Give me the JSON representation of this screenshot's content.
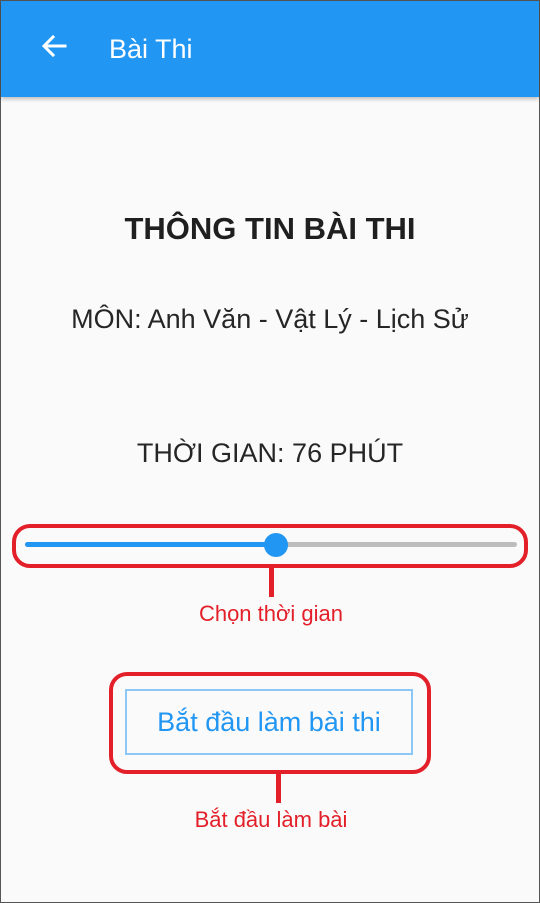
{
  "appbar": {
    "title": "Bài Thi",
    "back_icon": "arrow-left-icon",
    "color": "#2196f3"
  },
  "exam_info": {
    "heading": "THÔNG TIN BÀI THI",
    "subject": "MÔN: Anh Văn - Vật Lý - Lịch Sử",
    "time": "THỜI GIAN: 76 PHÚT"
  },
  "slider": {
    "value_fraction": 0.51,
    "active_color": "#2196f3",
    "track_color": "#bdbdbd"
  },
  "start_button": {
    "label": "Bắt đầu làm bài thi"
  },
  "annotations": {
    "slider_note": "Chọn thời gian",
    "button_note": "Bắt đầu làm bài",
    "color": "#e3202a"
  }
}
